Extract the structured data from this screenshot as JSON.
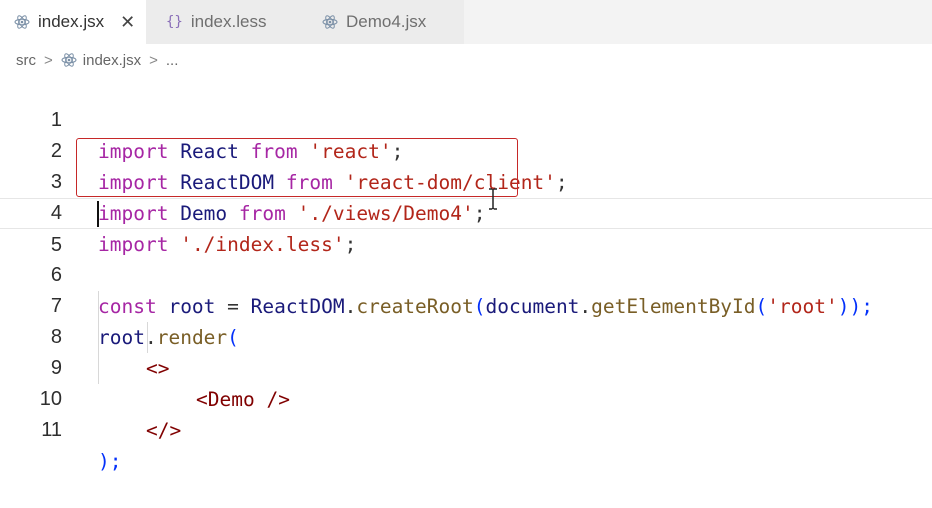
{
  "tabs": [
    {
      "label": "index.jsx",
      "icon": "react-icon",
      "active": true,
      "close": "✕"
    },
    {
      "label": "index.less",
      "icon": "braces-icon",
      "active": false
    },
    {
      "label": "Demo4.jsx",
      "icon": "react-icon",
      "active": false
    }
  ],
  "breadcrumb": {
    "folder": "src",
    "file": "index.jsx",
    "tail": "...",
    "sep": ">"
  },
  "editor": {
    "line_numbers": [
      "1",
      "2",
      "3",
      "4",
      "5",
      "6",
      "7",
      "8",
      "9",
      "10",
      "11"
    ],
    "lines": {
      "l1": {
        "kw1": "import",
        "name": "React",
        "kw2": "from",
        "str": "'react'",
        "end": ";"
      },
      "l2": {
        "kw1": "import",
        "name": "ReactDOM",
        "kw2": "from",
        "str": "'react-dom/client'",
        "end": ";"
      },
      "l3": {
        "kw1": "import",
        "name": "Demo",
        "kw2": "from",
        "str": "'./views/Demo4'",
        "end": ";"
      },
      "l4": {
        "kw1": "import",
        "str": "'./index.less'",
        "end": ";"
      },
      "l6": {
        "kw": "const",
        "var": "root",
        "eq": "=",
        "obj": "ReactDOM",
        "fn": "createRoot",
        "arg_obj": "document",
        "arg_fn": "getElementById",
        "str": "'root'",
        "end": "));"
      },
      "l7": {
        "obj": "root",
        "fn": "render",
        "open": "("
      },
      "l8": {
        "text": "<>"
      },
      "l9": {
        "open": "<",
        "tag": "Demo",
        "close": " />"
      },
      "l10": {
        "text": "</>"
      },
      "l11": {
        "text": ");"
      }
    }
  },
  "colors": {
    "highlight_box": "#c62828",
    "keyword": "#a626a4",
    "string": "#b2261a"
  }
}
